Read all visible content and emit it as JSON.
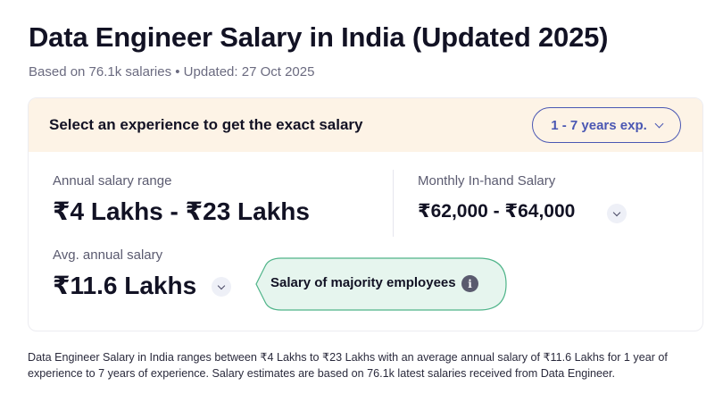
{
  "header": {
    "title": "Data Engineer Salary in India (Updated 2025)",
    "subtitle": "Based on 76.1k salaries • Updated: 27 Oct 2025"
  },
  "experience": {
    "prompt": "Select an experience to get the exact salary",
    "selected": "1 - 7 years exp."
  },
  "annual": {
    "label": "Annual salary range",
    "value": "₹4 Lakhs - ₹23 Lakhs"
  },
  "monthly": {
    "label": "Monthly In-hand Salary",
    "value": "₹62,000 - ₹64,000"
  },
  "average": {
    "label": "Avg. annual salary",
    "value": "₹11.6 Lakhs"
  },
  "tooltip": {
    "text": "Salary of majority employees",
    "icon": "info-icon"
  },
  "description": "Data Engineer Salary in India ranges between ₹4 Lakhs to ₹23 Lakhs with an average annual salary of ₹11.6 Lakhs for 1 year of experience to 7 years of experience. Salary estimates are based on 76.1k latest salaries received from Data Engineer.",
  "colors": {
    "accent": "#4a57b3",
    "header_bg": "#fdf3e6",
    "bubble_bg": "#e6f5ee",
    "bubble_border": "#4fb489"
  }
}
